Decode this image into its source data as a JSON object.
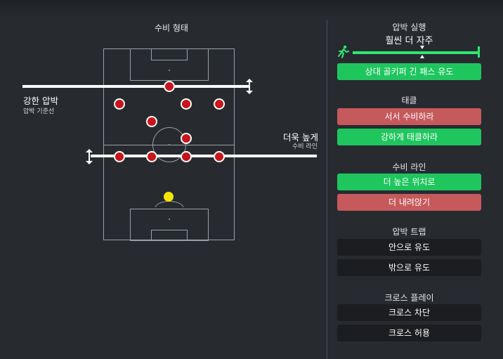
{
  "left": {
    "title": "수비 형태",
    "press_label": "강한 압박",
    "press_sub": "압박 기준선",
    "line_label": "더욱 높게",
    "line_sub": "수비 라인"
  },
  "right": {
    "pressing": {
      "title": "압박 실행",
      "frequency": "훨씬 더 자주",
      "slider_level": 0.55,
      "option": "상대 골키퍼 긴 패스 유도"
    },
    "tackle": {
      "title": "태클",
      "options": [
        "서서 수비하라",
        "강하게 태클하라"
      ]
    },
    "defensive_line": {
      "title": "수비 라인",
      "options": [
        "더 높은 위치로",
        "더 내려앉기"
      ]
    },
    "trap": {
      "title": "압박 트랩",
      "options": [
        "안으로 유도",
        "밖으로 유도"
      ]
    },
    "crosses": {
      "title": "크로스 플레이",
      "options": [
        "크로스 차단",
        "크로스 허용"
      ]
    }
  },
  "colors": {
    "selected": "#1fc65e",
    "deselected_active": "#c6595b",
    "inactive": "#1b1d20",
    "player": "#c8141a",
    "keeper": "#f5e400",
    "slider": "#2ee86f"
  }
}
